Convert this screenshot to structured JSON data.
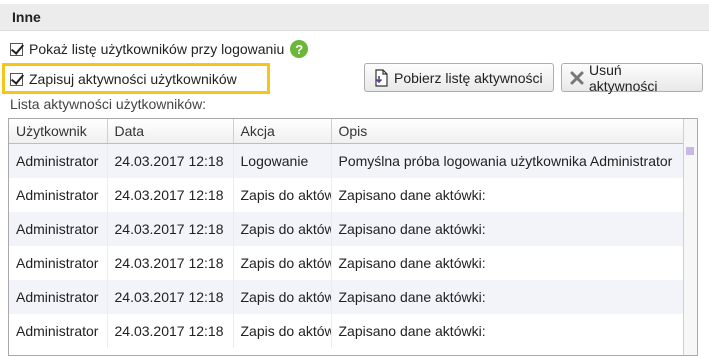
{
  "section": {
    "title": "Inne"
  },
  "options": {
    "show_users_label": "Pokaż listę użytkowników przy logowaniu",
    "show_users_checked": true,
    "log_activity_label": "Zapisuj aktywności użytkowników",
    "log_activity_checked": true
  },
  "buttons": {
    "download_label": "Pobierz listę aktywności",
    "delete_label": "Usuń aktywności"
  },
  "activity": {
    "list_label": "Lista aktywności użytkowników:",
    "columns": [
      "Użytkownik",
      "Data",
      "Akcja",
      "Opis"
    ],
    "rows": [
      [
        "Administrator",
        "24.03.2017 12:18",
        "Logowanie",
        "Pomyślna próba logowania użytkownika Administrator"
      ],
      [
        "Administrator",
        "24.03.2017 12:18",
        "Zapis do aktówki",
        "Zapisano dane aktówki:"
      ],
      [
        "Administrator",
        "24.03.2017 12:18",
        "Zapis do aktówki",
        "Zapisano dane aktówki:"
      ],
      [
        "Administrator",
        "24.03.2017 12:18",
        "Zapis do aktówki",
        "Zapisano dane aktówki:"
      ],
      [
        "Administrator",
        "24.03.2017 12:18",
        "Zapis do aktówki",
        "Zapisano dane aktówki:"
      ],
      [
        "Administrator",
        "24.03.2017 12:18",
        "Zapis do aktówki",
        "Zapisano dane aktówki:"
      ]
    ]
  },
  "colors": {
    "highlight": "#f5c518",
    "help_icon": "#6ab73a",
    "row_alt": "#f2f4fa"
  }
}
